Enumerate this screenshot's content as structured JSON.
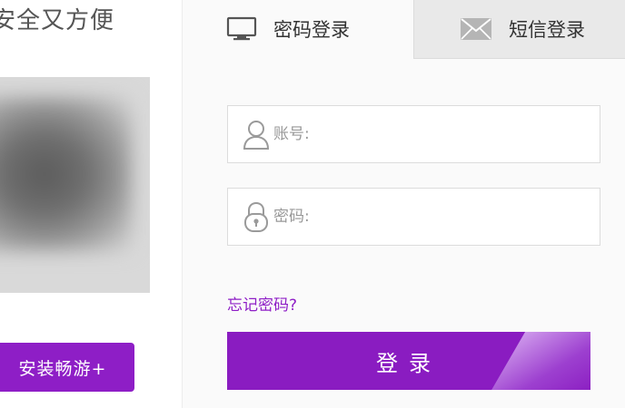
{
  "left": {
    "promo_text": "安全又方便",
    "install_button": "安装畅游+"
  },
  "tabs": {
    "password": "密码登录",
    "sms": "短信登录"
  },
  "form": {
    "account_placeholder": "账号:",
    "password_placeholder": "密码:",
    "forgot": "忘记密码?",
    "login": "登录"
  },
  "colors": {
    "brand_purple": "#8e1ec6",
    "tab_inactive_bg": "#e9e9e9",
    "field_border": "#dcdcdc"
  },
  "icons": {
    "tab_password": "monitor-icon",
    "tab_sms": "envelope-icon",
    "account": "user-icon",
    "password": "lock-icon"
  }
}
